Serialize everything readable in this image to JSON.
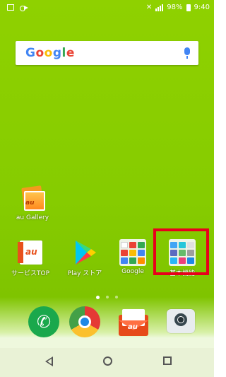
{
  "status_bar": {
    "battery_percent": "98%",
    "time": "9:40"
  },
  "search_bar": {
    "logo_text": "Google",
    "mic_icon": "mic-icon"
  },
  "desktop": {
    "gallery_label": "au Gallery"
  },
  "row": {
    "apps": [
      {
        "label": "サービスTOP",
        "icon": "au-service-icon"
      },
      {
        "label": "Play ストア",
        "icon": "play-store-icon"
      },
      {
        "label": "Google",
        "icon": "google-folder-icon"
      },
      {
        "label": "基本機能",
        "icon": "basic-functions-folder-icon"
      }
    ]
  },
  "highlight": {
    "color": "#e8001c",
    "target": "basic-functions-folder"
  },
  "hotseat": {
    "apps": [
      {
        "icon": "phone-icon"
      },
      {
        "icon": "chrome-icon"
      },
      {
        "icon": "au-mail-icon"
      },
      {
        "icon": "camera-icon"
      }
    ]
  },
  "navigation": {
    "icons": [
      "back-icon",
      "home-icon",
      "recent-apps-icon"
    ]
  },
  "colors": {
    "wallpaper": "#86cc00",
    "highlight": "#e8001c"
  }
}
